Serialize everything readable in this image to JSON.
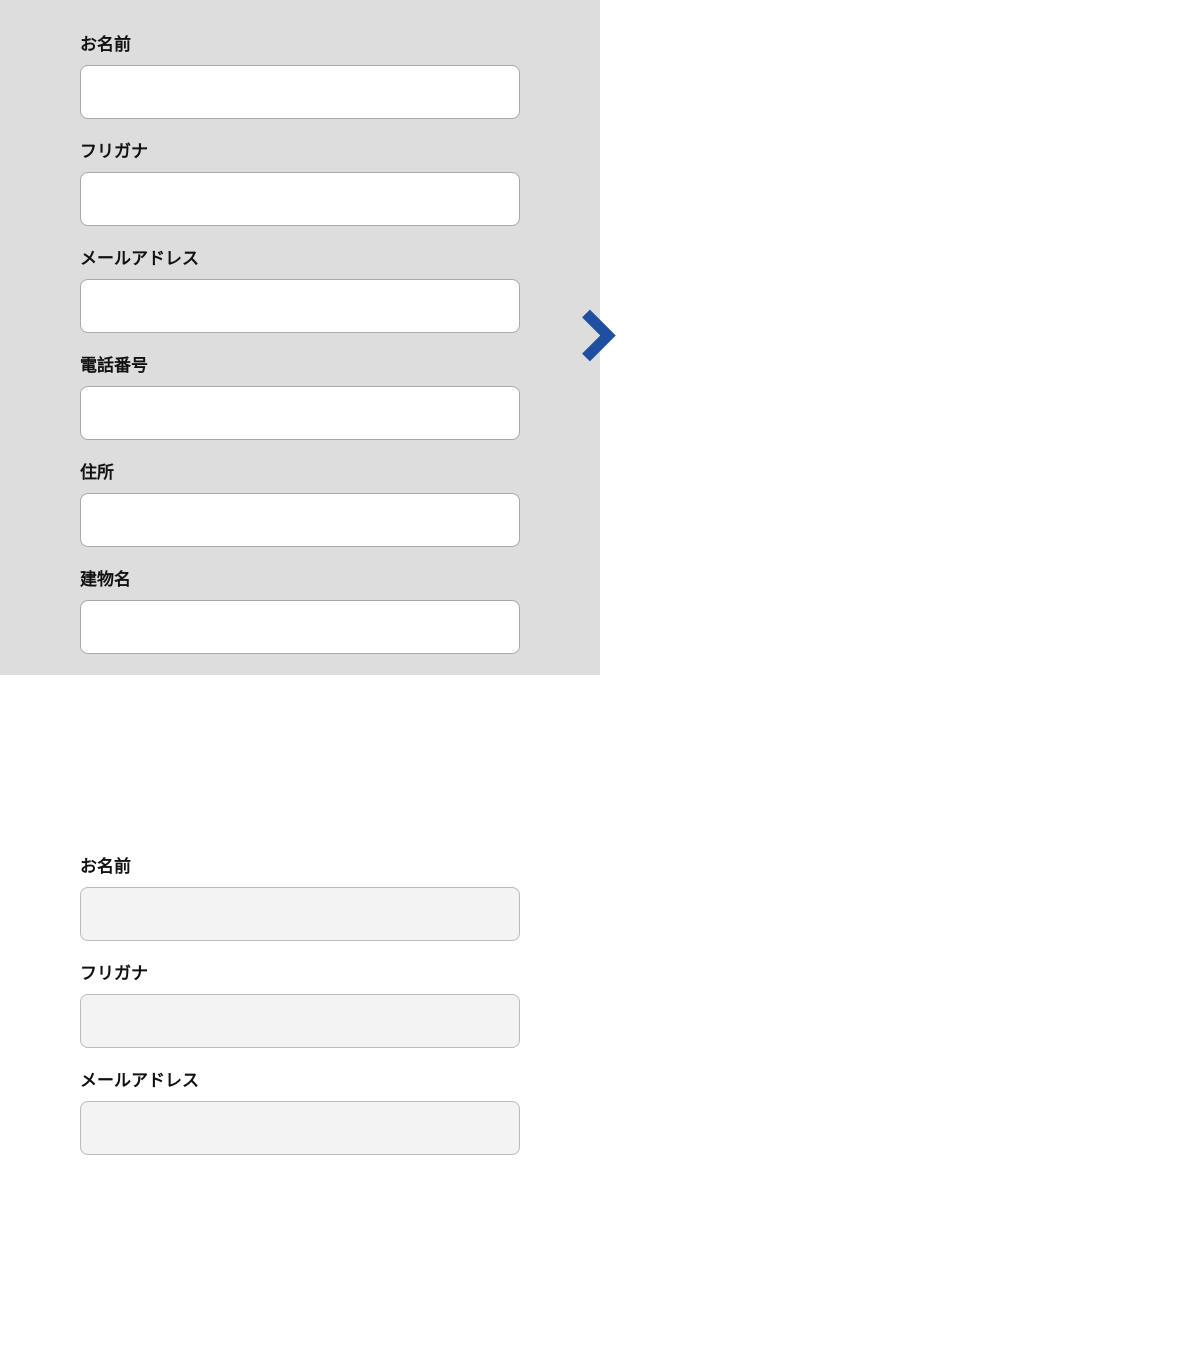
{
  "left_form": {
    "fields": [
      {
        "label": "お名前",
        "value": ""
      },
      {
        "label": "フリガナ",
        "value": ""
      },
      {
        "label": "メールアドレス",
        "value": ""
      },
      {
        "label": "電話番号",
        "value": ""
      },
      {
        "label": "住所",
        "value": ""
      },
      {
        "label": "建物名",
        "value": ""
      }
    ]
  },
  "right_form": {
    "fields": [
      {
        "label": "お名前",
        "value": ""
      },
      {
        "label": "フリガナ",
        "value": ""
      },
      {
        "label": "メールアドレス",
        "value": ""
      }
    ]
  },
  "colors": {
    "arrow": "#1f4fa0",
    "panel_left_bg": "#dddddd",
    "panel_right_bg": "#ffffff"
  }
}
